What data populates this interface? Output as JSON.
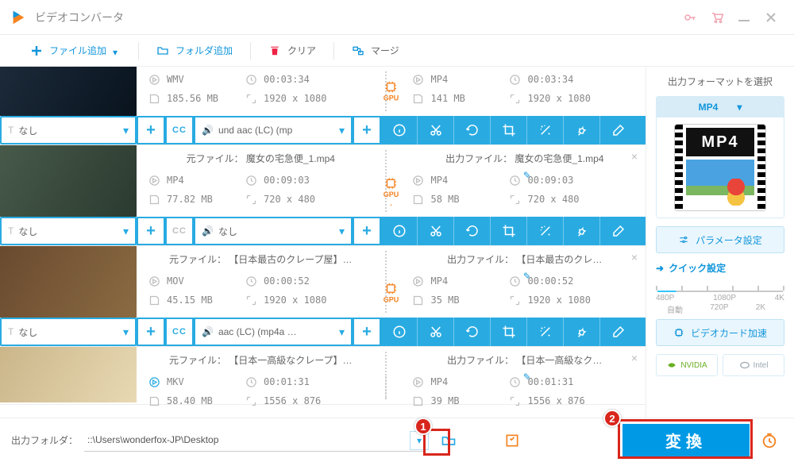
{
  "app": {
    "title": "ビデオコンバータ"
  },
  "toolbar": {
    "addFile": "ファイル追加",
    "addFolder": "フォルダ追加",
    "clear": "クリア",
    "merge": "マージ"
  },
  "items": [
    {
      "src": {
        "fmt": "WMV",
        "size": "185.56 MB",
        "dur": "00:03:34",
        "dim": "1920 x 1080"
      },
      "dst": {
        "fmt": "MP4",
        "size": "141 MB",
        "dur": "00:03:34",
        "dim": "1920 x 1080"
      },
      "sub": "なし",
      "audio": "und aac (LC) (mp",
      "cc": true,
      "gpu": "GPU"
    },
    {
      "srcTitle": "元ファイル：  魔女の宅急便_1.mp4",
      "dstTitle": "出力ファイル：  魔女の宅急便_1.mp4",
      "src": {
        "fmt": "MP4",
        "size": "77.82 MB",
        "dur": "00:09:03",
        "dim": "720 x 480"
      },
      "dst": {
        "fmt": "MP4",
        "size": "58 MB",
        "dur": "00:09:03",
        "dim": "720 x 480"
      },
      "sub": "なし",
      "audio": "なし",
      "cc": false,
      "gpu": "GPU"
    },
    {
      "srcTitle": "元ファイル：  【日本最古のクレープ屋】…",
      "dstTitle": "出力ファイル：  【日本最古のクレ…",
      "src": {
        "fmt": "MOV",
        "size": "45.15 MB",
        "dur": "00:00:52",
        "dim": "1920 x 1080"
      },
      "dst": {
        "fmt": "MP4",
        "size": "35 MB",
        "dur": "00:00:52",
        "dim": "1920 x 1080"
      },
      "sub": "なし",
      "audio": "aac (LC) (mp4a …",
      "cc": true,
      "gpu": "GPU"
    },
    {
      "srcTitle": "元ファイル：  【日本一高級なクレープ】…",
      "dstTitle": "出力ファイル：  【日本一高級なク…",
      "src": {
        "fmt": "MKV",
        "size": "58.40 MB",
        "dur": "00:01:31",
        "dim": "1556 x 876"
      },
      "dst": {
        "fmt": "MP4",
        "size": "39 MB",
        "dur": "00:01:31",
        "dim": "1556 x 876"
      }
    }
  ],
  "side": {
    "title": "出力フォーマットを選択",
    "format": "MP4",
    "paramBtn": "パラメータ設定",
    "quick": "クイック設定",
    "ticks1": [
      "480P",
      "1080P",
      "4K"
    ],
    "ticks2": [
      "自動",
      "720P",
      "2K"
    ],
    "gpuBtn": "ビデオカード加速",
    "nvidia": "NVIDIA",
    "intel": "Intel"
  },
  "footer": {
    "label": "出力フォルダ：",
    "path": "::\\Users\\wonderfox-JP\\Desktop",
    "convert": "変換"
  },
  "callouts": {
    "one": "1",
    "two": "2"
  }
}
